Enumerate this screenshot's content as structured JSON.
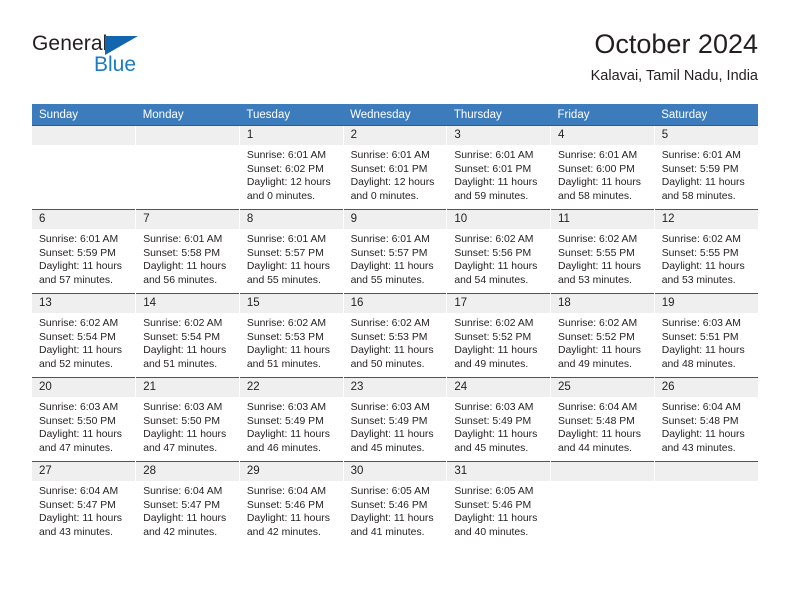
{
  "brand": {
    "name_part1": "General",
    "name_part2": "Blue",
    "flag_icon": "triangle-flag-icon"
  },
  "header": {
    "title": "October 2024",
    "subtitle": "Kalavai, Tamil Nadu, India"
  },
  "colors": {
    "header_bar": "#3c7cbd",
    "brand_blue": "#1b7cc4",
    "flag_blue": "#1266ad",
    "day_band": "#efefef",
    "grid_line": "#1f5fa0",
    "text": "#231f20"
  },
  "weekday_headers": [
    "Sunday",
    "Monday",
    "Tuesday",
    "Wednesday",
    "Thursday",
    "Friday",
    "Saturday"
  ],
  "weeks": [
    [
      {
        "day": "",
        "lines": []
      },
      {
        "day": "",
        "lines": []
      },
      {
        "day": "1",
        "lines": [
          "Sunrise: 6:01 AM",
          "Sunset: 6:02 PM",
          "Daylight: 12 hours",
          "and 0 minutes."
        ]
      },
      {
        "day": "2",
        "lines": [
          "Sunrise: 6:01 AM",
          "Sunset: 6:01 PM",
          "Daylight: 12 hours",
          "and 0 minutes."
        ]
      },
      {
        "day": "3",
        "lines": [
          "Sunrise: 6:01 AM",
          "Sunset: 6:01 PM",
          "Daylight: 11 hours",
          "and 59 minutes."
        ]
      },
      {
        "day": "4",
        "lines": [
          "Sunrise: 6:01 AM",
          "Sunset: 6:00 PM",
          "Daylight: 11 hours",
          "and 58 minutes."
        ]
      },
      {
        "day": "5",
        "lines": [
          "Sunrise: 6:01 AM",
          "Sunset: 5:59 PM",
          "Daylight: 11 hours",
          "and 58 minutes."
        ]
      }
    ],
    [
      {
        "day": "6",
        "lines": [
          "Sunrise: 6:01 AM",
          "Sunset: 5:59 PM",
          "Daylight: 11 hours",
          "and 57 minutes."
        ]
      },
      {
        "day": "7",
        "lines": [
          "Sunrise: 6:01 AM",
          "Sunset: 5:58 PM",
          "Daylight: 11 hours",
          "and 56 minutes."
        ]
      },
      {
        "day": "8",
        "lines": [
          "Sunrise: 6:01 AM",
          "Sunset: 5:57 PM",
          "Daylight: 11 hours",
          "and 55 minutes."
        ]
      },
      {
        "day": "9",
        "lines": [
          "Sunrise: 6:01 AM",
          "Sunset: 5:57 PM",
          "Daylight: 11 hours",
          "and 55 minutes."
        ]
      },
      {
        "day": "10",
        "lines": [
          "Sunrise: 6:02 AM",
          "Sunset: 5:56 PM",
          "Daylight: 11 hours",
          "and 54 minutes."
        ]
      },
      {
        "day": "11",
        "lines": [
          "Sunrise: 6:02 AM",
          "Sunset: 5:55 PM",
          "Daylight: 11 hours",
          "and 53 minutes."
        ]
      },
      {
        "day": "12",
        "lines": [
          "Sunrise: 6:02 AM",
          "Sunset: 5:55 PM",
          "Daylight: 11 hours",
          "and 53 minutes."
        ]
      }
    ],
    [
      {
        "day": "13",
        "lines": [
          "Sunrise: 6:02 AM",
          "Sunset: 5:54 PM",
          "Daylight: 11 hours",
          "and 52 minutes."
        ]
      },
      {
        "day": "14",
        "lines": [
          "Sunrise: 6:02 AM",
          "Sunset: 5:54 PM",
          "Daylight: 11 hours",
          "and 51 minutes."
        ]
      },
      {
        "day": "15",
        "lines": [
          "Sunrise: 6:02 AM",
          "Sunset: 5:53 PM",
          "Daylight: 11 hours",
          "and 51 minutes."
        ]
      },
      {
        "day": "16",
        "lines": [
          "Sunrise: 6:02 AM",
          "Sunset: 5:53 PM",
          "Daylight: 11 hours",
          "and 50 minutes."
        ]
      },
      {
        "day": "17",
        "lines": [
          "Sunrise: 6:02 AM",
          "Sunset: 5:52 PM",
          "Daylight: 11 hours",
          "and 49 minutes."
        ]
      },
      {
        "day": "18",
        "lines": [
          "Sunrise: 6:02 AM",
          "Sunset: 5:52 PM",
          "Daylight: 11 hours",
          "and 49 minutes."
        ]
      },
      {
        "day": "19",
        "lines": [
          "Sunrise: 6:03 AM",
          "Sunset: 5:51 PM",
          "Daylight: 11 hours",
          "and 48 minutes."
        ]
      }
    ],
    [
      {
        "day": "20",
        "lines": [
          "Sunrise: 6:03 AM",
          "Sunset: 5:50 PM",
          "Daylight: 11 hours",
          "and 47 minutes."
        ]
      },
      {
        "day": "21",
        "lines": [
          "Sunrise: 6:03 AM",
          "Sunset: 5:50 PM",
          "Daylight: 11 hours",
          "and 47 minutes."
        ]
      },
      {
        "day": "22",
        "lines": [
          "Sunrise: 6:03 AM",
          "Sunset: 5:49 PM",
          "Daylight: 11 hours",
          "and 46 minutes."
        ]
      },
      {
        "day": "23",
        "lines": [
          "Sunrise: 6:03 AM",
          "Sunset: 5:49 PM",
          "Daylight: 11 hours",
          "and 45 minutes."
        ]
      },
      {
        "day": "24",
        "lines": [
          "Sunrise: 6:03 AM",
          "Sunset: 5:49 PM",
          "Daylight: 11 hours",
          "and 45 minutes."
        ]
      },
      {
        "day": "25",
        "lines": [
          "Sunrise: 6:04 AM",
          "Sunset: 5:48 PM",
          "Daylight: 11 hours",
          "and 44 minutes."
        ]
      },
      {
        "day": "26",
        "lines": [
          "Sunrise: 6:04 AM",
          "Sunset: 5:48 PM",
          "Daylight: 11 hours",
          "and 43 minutes."
        ]
      }
    ],
    [
      {
        "day": "27",
        "lines": [
          "Sunrise: 6:04 AM",
          "Sunset: 5:47 PM",
          "Daylight: 11 hours",
          "and 43 minutes."
        ]
      },
      {
        "day": "28",
        "lines": [
          "Sunrise: 6:04 AM",
          "Sunset: 5:47 PM",
          "Daylight: 11 hours",
          "and 42 minutes."
        ]
      },
      {
        "day": "29",
        "lines": [
          "Sunrise: 6:04 AM",
          "Sunset: 5:46 PM",
          "Daylight: 11 hours",
          "and 42 minutes."
        ]
      },
      {
        "day": "30",
        "lines": [
          "Sunrise: 6:05 AM",
          "Sunset: 5:46 PM",
          "Daylight: 11 hours",
          "and 41 minutes."
        ]
      },
      {
        "day": "31",
        "lines": [
          "Sunrise: 6:05 AM",
          "Sunset: 5:46 PM",
          "Daylight: 11 hours",
          "and 40 minutes."
        ]
      },
      {
        "day": "",
        "lines": []
      },
      {
        "day": "",
        "lines": []
      }
    ]
  ]
}
